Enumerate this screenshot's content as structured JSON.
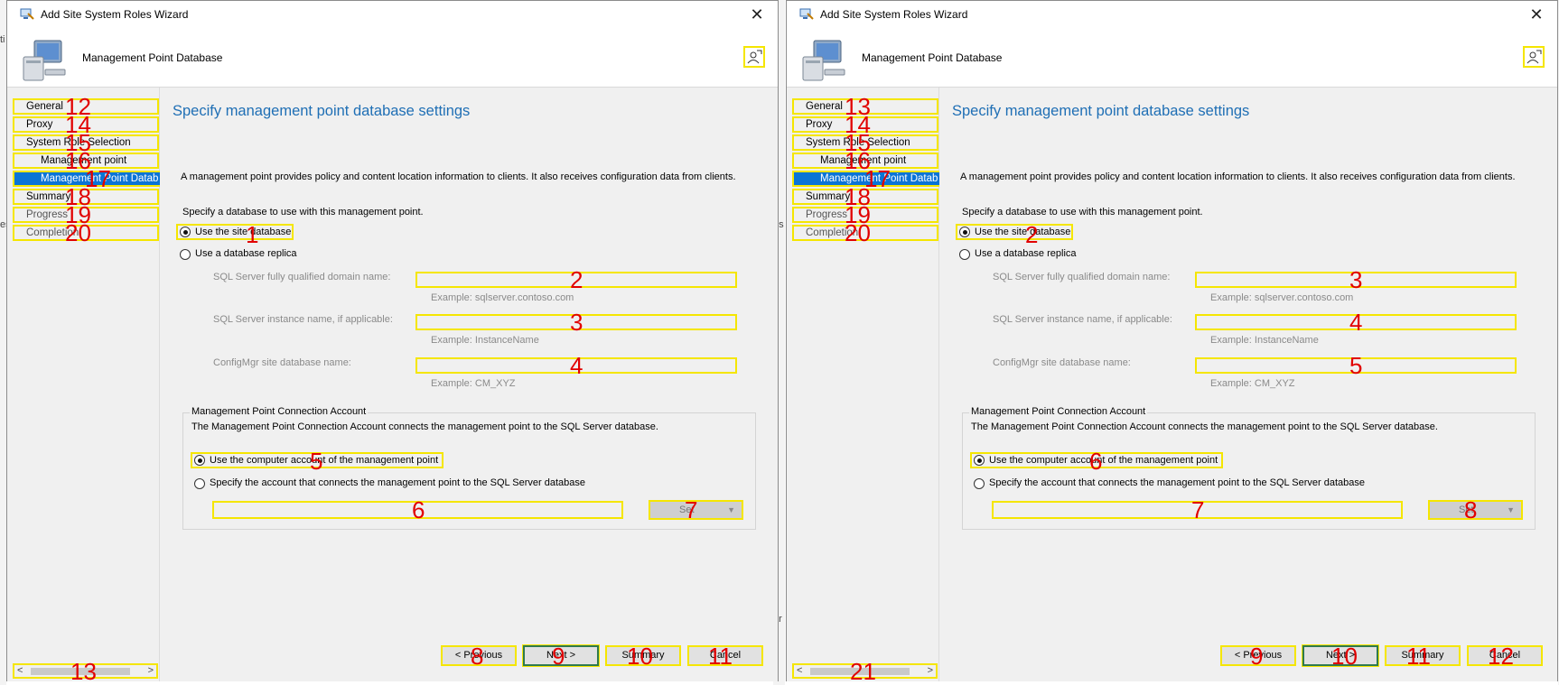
{
  "background": {
    "cut_labels": [
      "ti",
      "ar",
      "es"
    ]
  },
  "panels": [
    {
      "window_title": "Add Site System Roles Wizard",
      "header_title": "Management Point Database",
      "nav": [
        {
          "label": "General",
          "marker": "12"
        },
        {
          "label": "Proxy",
          "marker": "14"
        },
        {
          "label": "System Role Selection",
          "marker": "15"
        },
        {
          "label": "Management point",
          "marker": "16"
        },
        {
          "label": "Management Point Datab",
          "marker": "17"
        },
        {
          "label": "Summary",
          "marker": "18"
        },
        {
          "label": "Progress",
          "marker": "19"
        },
        {
          "label": "Completion",
          "marker": "20"
        }
      ],
      "scroll_marker": "13",
      "heading": "Specify management point database settings",
      "description": "A management point provides policy and content location information to clients.  It also receives configuration data from clients.",
      "specify": "Specify a database to use with this management point.",
      "radio_site_db": {
        "label": "Use the site database",
        "marker": "1"
      },
      "radio_replica": {
        "label": "Use a database replica"
      },
      "field_fqdn": {
        "label": "SQL Server fully qualified domain name:",
        "example": "Example: sqlserver.contoso.com",
        "marker": "2",
        "value": ""
      },
      "field_instance": {
        "label": "SQL Server instance name, if applicable:",
        "example": "Example: InstanceName",
        "marker": "3",
        "value": ""
      },
      "field_dbname": {
        "label": "ConfigMgr site database name:",
        "example": "Example: CM_XYZ",
        "marker": "4",
        "value": ""
      },
      "group_title": "Management Point Connection Account",
      "group_desc": "The Management Point Connection Account connects the management point to the SQL Server database.",
      "radio_computer_acct": {
        "label": "Use the computer account of the management point",
        "marker": "5"
      },
      "radio_specify_acct": {
        "label": "Specify the account that connects the management point to the SQL Server database"
      },
      "account_input": {
        "marker": "6",
        "value": ""
      },
      "set_button": {
        "label": "Set",
        "marker": "7"
      },
      "buttons": {
        "previous": {
          "label": "< Previous",
          "marker": "8"
        },
        "next": {
          "label": "Next >",
          "marker": "9"
        },
        "summary": {
          "label": "Summary",
          "marker": "10"
        },
        "cancel": {
          "label": "Cancel",
          "marker": "11"
        }
      }
    },
    {
      "window_title": "Add Site System Roles Wizard",
      "header_title": "Management Point Database",
      "nav": [
        {
          "label": "General",
          "marker": "13"
        },
        {
          "label": "Proxy",
          "marker": "14"
        },
        {
          "label": "System Role Selection",
          "marker": "15"
        },
        {
          "label": "Management point",
          "marker": "16"
        },
        {
          "label": "Management Point Datab",
          "marker": "17"
        },
        {
          "label": "Summary",
          "marker": "18"
        },
        {
          "label": "Progress",
          "marker": "19"
        },
        {
          "label": "Completion",
          "marker": "20"
        }
      ],
      "scroll_marker": "21",
      "heading": "Specify management point database settings",
      "description": "A management point provides policy and content location information to clients.  It also receives configuration data from clients.",
      "specify": "Specify a database to use with this management point.",
      "radio_site_db": {
        "label": "Use the site database",
        "marker": "2"
      },
      "radio_replica": {
        "label": "Use a database replica"
      },
      "field_fqdn": {
        "label": "SQL Server fully qualified domain name:",
        "example": "Example: sqlserver.contoso.com",
        "marker": "3",
        "value": ""
      },
      "field_instance": {
        "label": "SQL Server instance name, if applicable:",
        "example": "Example: InstanceName",
        "marker": "4",
        "value": ""
      },
      "field_dbname": {
        "label": "ConfigMgr site database name:",
        "example": "Example: CM_XYZ",
        "marker": "5",
        "value": ""
      },
      "group_title": "Management Point Connection Account",
      "group_desc": "The Management Point Connection Account connects the management point to the SQL Server database.",
      "radio_computer_acct": {
        "label": "Use the computer account of the management point",
        "marker": "6"
      },
      "radio_specify_acct": {
        "label": "Specify the account that connects the management point to the SQL Server database"
      },
      "account_input": {
        "marker": "7",
        "value": ""
      },
      "set_button": {
        "label": "Set",
        "marker": "8"
      },
      "buttons": {
        "previous": {
          "label": "< Previous",
          "marker": "9"
        },
        "next": {
          "label": "Next >",
          "marker": "10"
        },
        "summary": {
          "label": "Summary",
          "marker": "11"
        },
        "cancel": {
          "label": "Cancel",
          "marker": "12"
        }
      }
    }
  ]
}
